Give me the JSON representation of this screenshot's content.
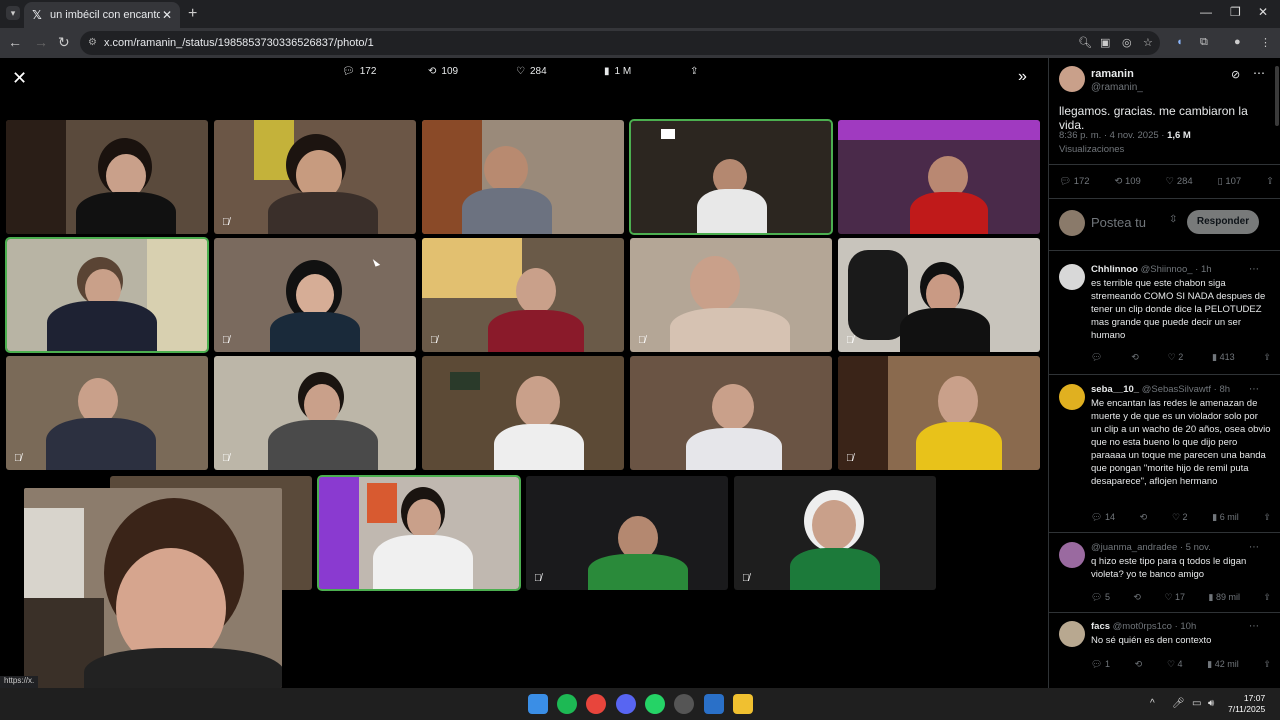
{
  "browser": {
    "tab_title": "un imbécil con encanto (@sist...",
    "url": "x.com/ramanin_/status/1985853730336526837/photo/1",
    "status_link": "https://x."
  },
  "viewer": {
    "stats": {
      "replies": "172",
      "reposts": "109",
      "likes": "284",
      "views": "1 M"
    }
  },
  "post": {
    "author_name": "ramanin",
    "author_handle": "@ramanin_",
    "text": "llegamos. gracias. me cambiaron la vida.",
    "time": "8:36 p. m. · 4 nov. 2025 · ",
    "views_count": "1,6 M",
    "views_label": "Visualizaciones",
    "actions": {
      "replies": "172",
      "reposts": "109",
      "likes": "284",
      "bookmarks": "107"
    },
    "reply_placeholder": "Postea tu",
    "reply_button": "Responder"
  },
  "replies": [
    {
      "name": "Chhlinnoo",
      "handle": "@Shiinnoo_ · 1h",
      "text": "es terrible que este chabon siga stremeando COMO SI NADA despues de tener un clip donde dice la PELOTUDEZ mas grande que puede decir un ser humano",
      "replies": "",
      "reposts": "",
      "likes": "2",
      "views": "413"
    },
    {
      "name": "seba__10_",
      "handle": "@SebasSilvawtf · 8h",
      "text": "Me encantan las redes le amenazan de muerte y de que es un violador solo por un clip a un wacho de 20 años, osea obvio que no esta bueno lo que dijo pero paraaaa un toque me parecen una banda que pongan \"morite hijo de remil puta desaparece\", aflojen hermano",
      "replies": "14",
      "reposts": "",
      "likes": "2",
      "views": "6 mil"
    },
    {
      "name": "",
      "handle": "@juanma_andradee · 5 nov.",
      "text": "q hizo este tipo para q todos le digan violeta? yo te banco amigo",
      "replies": "5",
      "reposts": "",
      "likes": "17",
      "views": "89 mil"
    },
    {
      "name": "facs",
      "handle": "@mot0rps1co · 10h",
      "text": "No sé quién es den contexto",
      "replies": "1",
      "reposts": "",
      "likes": "4",
      "views": "42 mil"
    }
  ],
  "taskbar": {
    "time": "17:07",
    "date": "7/11/2025"
  },
  "colors": {
    "active_tile": "#4caf50",
    "x_bg": "#000000",
    "muted_text": "#71767b"
  }
}
